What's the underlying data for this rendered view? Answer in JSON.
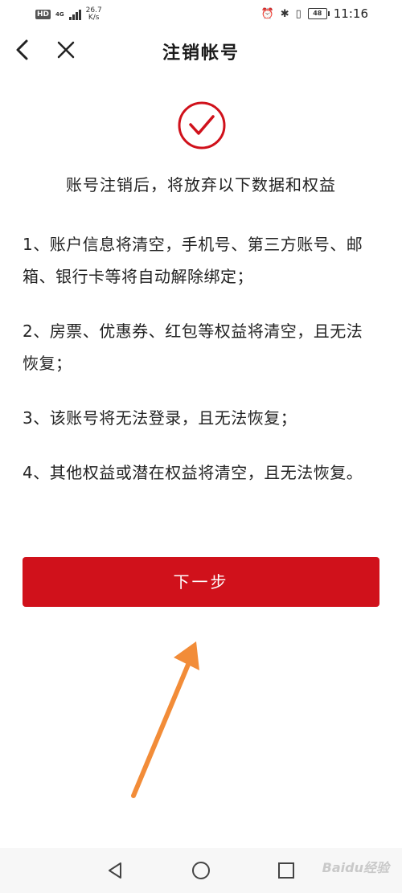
{
  "status_bar": {
    "hd_label": "HD",
    "network_type": "4G",
    "speed_value": "26.7",
    "speed_unit": "K/s",
    "battery": "48",
    "time": "11:16"
  },
  "header": {
    "title": "注销帐号",
    "back_icon": "chevron-left",
    "close_icon": "close-x"
  },
  "main": {
    "success_icon": "check-circle",
    "accent_color": "#d0111b",
    "subtitle": "账号注销后，将放弃以下数据和权益",
    "terms": [
      "1、账户信息将清空，手机号、第三方账号、邮箱、银行卡等将自动解除绑定；",
      "2、房票、优惠券、红包等权益将清空，且无法恢复；",
      "3、该账号将无法登录，且无法恢复；",
      "4、其他权益或潜在权益将清空，且无法恢复。"
    ],
    "next_button": "下一步"
  },
  "annotation": {
    "arrow_color": "#f28c38"
  },
  "system_nav": {
    "back_icon": "triangle-back",
    "home_icon": "circle-home",
    "recent_icon": "square-recent"
  },
  "watermark": "Baidu经验"
}
